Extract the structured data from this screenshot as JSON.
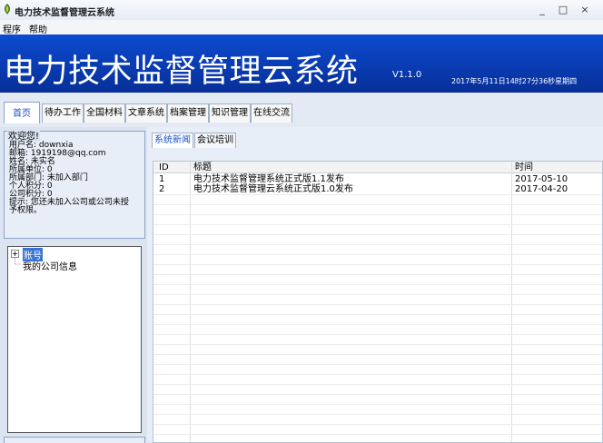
{
  "window": {
    "title": "电力技术监督管理云系统",
    "minimize": "_",
    "maximize": "□",
    "close": "×"
  },
  "menu": [
    "程序",
    "帮助"
  ],
  "banner": {
    "title": "电力技术监督管理云系统",
    "version": "V1.1.0",
    "datetime": "2017年5月11日14时27分36秒星期四"
  },
  "tabs": [
    "首页",
    "待办工作",
    "全国材料",
    "文章系统",
    "档案管理",
    "知识管理",
    "在线交流"
  ],
  "welcome": {
    "legend": "欢迎您!",
    "lines": [
      "用户名: downxia",
      "邮箱: 1919198@qq.com",
      "姓名: 未实名",
      "所属单位: 0",
      "所属部门: 未加入部门",
      "个人积分: 0",
      "公司积分: 0",
      "提示: 您还未加入公司或公司未授",
      "予权限。"
    ]
  },
  "tree": {
    "root": "账号",
    "child": "我的公司信息"
  },
  "subtabs": [
    "系统新闻",
    "会议培训"
  ],
  "table": {
    "columns": [
      "ID",
      "标题",
      "时间"
    ],
    "rows": [
      {
        "id": "1",
        "title": "电力技术监督管理系统正式版1.1发布",
        "time": "2017-05-10"
      },
      {
        "id": "2",
        "title": "电力技术监督管理云系统正式版1.0发布",
        "time": "2017-04-20"
      }
    ]
  },
  "colors": {
    "banner": "#0a3db8",
    "accent": "#1a50c8"
  }
}
